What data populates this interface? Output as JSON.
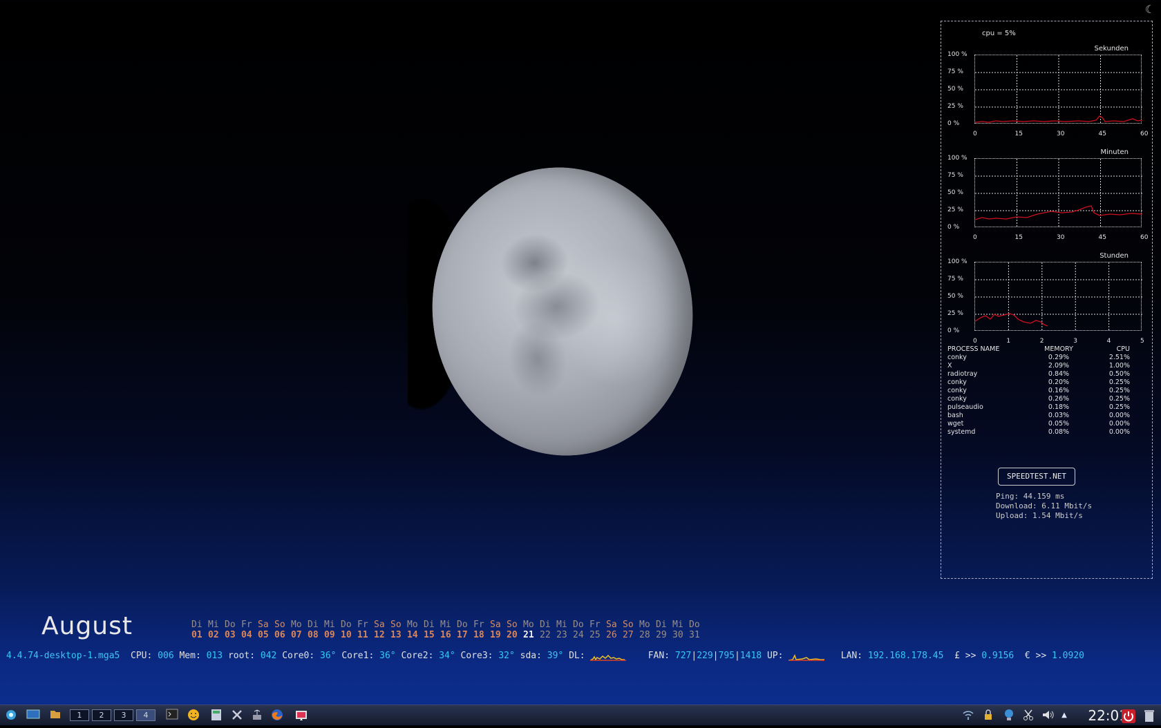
{
  "conky": {
    "cpu_label": "cpu = 5%",
    "y_ticks": [
      "100 %",
      "75 %",
      "50 %",
      "25 %",
      "0 %"
    ],
    "graphs": [
      {
        "title": "Sekunden",
        "x_ticks": [
          "0",
          "15",
          "30",
          "45",
          "60"
        ]
      },
      {
        "title": "Minuten",
        "x_ticks": [
          "0",
          "15",
          "30",
          "45",
          "60"
        ]
      },
      {
        "title": "Stunden",
        "x_ticks": [
          "0",
          "1",
          "2",
          "3",
          "4",
          "5"
        ]
      }
    ],
    "process_headers": {
      "name": "PROCESS NAME",
      "memory": "MEMORY",
      "cpu": "CPU"
    },
    "processes": [
      {
        "name": "conky",
        "memory": "0.29%",
        "cpu": "2.51%"
      },
      {
        "name": "X",
        "memory": "2.09%",
        "cpu": "1.00%"
      },
      {
        "name": "radiotray",
        "memory": "0.84%",
        "cpu": "0.50%"
      },
      {
        "name": "conky",
        "memory": "0.20%",
        "cpu": "0.25%"
      },
      {
        "name": "conky",
        "memory": "0.16%",
        "cpu": "0.25%"
      },
      {
        "name": "conky",
        "memory": "0.26%",
        "cpu": "0.25%"
      },
      {
        "name": "pulseaudio",
        "memory": "0.18%",
        "cpu": "0.25%"
      },
      {
        "name": "bash",
        "memory": "0.03%",
        "cpu": "0.00%"
      },
      {
        "name": "wget",
        "memory": "0.05%",
        "cpu": "0.00%"
      },
      {
        "name": "systemd",
        "memory": "0.08%",
        "cpu": "0.00%"
      }
    ],
    "speedtest_label": "SPEEDTEST.NET",
    "ping": "Ping: 44.159 ms",
    "download": "Download: 6.11 Mbit/s",
    "upload": "Upload: 1.54 Mbit/s"
  },
  "calendar": {
    "month": "August",
    "weekdays": [
      "Di",
      "Mi",
      "Do",
      "Fr",
      "Sa",
      "So",
      "Mo",
      "Di",
      "Mi",
      "Do",
      "Fr",
      "Sa",
      "So",
      "Mo",
      "Di",
      "Mi",
      "Do",
      "Fr",
      "Sa",
      "So",
      "Mo",
      "Di",
      "Mi",
      "Do",
      "Fr",
      "Sa",
      "So",
      "Mo",
      "Di",
      "Mi",
      "Do"
    ],
    "days": [
      "01",
      "02",
      "03",
      "04",
      "05",
      "06",
      "07",
      "08",
      "09",
      "10",
      "11",
      "12",
      "13",
      "14",
      "15",
      "16",
      "17",
      "18",
      "19",
      "20",
      "21",
      "22",
      "23",
      "24",
      "25",
      "26",
      "27",
      "28",
      "29",
      "30",
      "31"
    ],
    "today": "21"
  },
  "status": {
    "kernel": "4.4.74-desktop-1.mga5",
    "cpu_label": "CPU:",
    "cpu": "006",
    "mem_label": "Mem:",
    "mem": "013",
    "root_label": "root:",
    "root": "042",
    "core0_label": "Core0:",
    "core0": "36°",
    "core1_label": "Core1:",
    "core1": "36°",
    "core2_label": "Core2:",
    "core2": "34°",
    "core3_label": "Core3:",
    "core3": "32°",
    "sda_label": "sda:",
    "sda": "39°",
    "dl_label": "DL:",
    "fan_label": "FAN:",
    "fan1": "727",
    "fan2": "229",
    "fan3": "795",
    "fan4": "1418",
    "sep": "|",
    "up_label": "UP:",
    "lan_label": "LAN:",
    "lan": "192.168.178.45",
    "gbp_label": "£ >>",
    "gbp": "0.9156",
    "eur_label": "€ >>",
    "eur": "1.0920"
  },
  "taskbar": {
    "desktops": [
      "1",
      "2",
      "3",
      "4"
    ],
    "clock": "22:01"
  },
  "colors": {
    "accent_cyan": "#36c8f5",
    "graph_line": "#d01020",
    "weekend": "#d28d6e"
  }
}
